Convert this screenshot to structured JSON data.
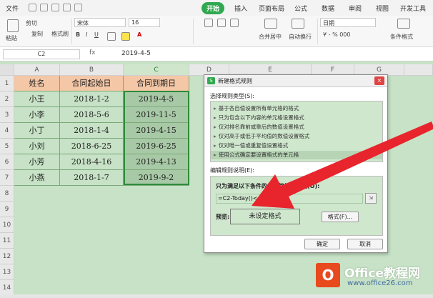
{
  "menubar": {
    "file": "文件",
    "tabs": [
      {
        "label": "开始",
        "active": true
      },
      {
        "label": "插入"
      },
      {
        "label": "页面布局"
      },
      {
        "label": "公式"
      },
      {
        "label": "数据"
      },
      {
        "label": "审阅"
      },
      {
        "label": "视图"
      },
      {
        "label": "开发工具"
      }
    ]
  },
  "ribbon": {
    "cut": "剪切",
    "paste": "粘贴",
    "copy": "复制",
    "format_painter": "格式刷",
    "font_name": "宋体",
    "font_size": "16",
    "merge_center": "合并居中",
    "wrap_text": "自动换行",
    "number_format": "日期",
    "conditional_format": "条件格式"
  },
  "formula_bar": {
    "name_box": "C2",
    "fx": "fx",
    "content": "2019-4-5"
  },
  "grid": {
    "columns": [
      "A",
      "B",
      "C",
      "D",
      "E",
      "F",
      "G"
    ],
    "rows": [
      "1",
      "2",
      "3",
      "4",
      "5",
      "6",
      "7",
      "8",
      "9",
      "10",
      "11",
      "12",
      "13",
      "14"
    ],
    "header": [
      "姓名",
      "合同起始日",
      "合同到期日"
    ],
    "data": [
      [
        "小王",
        "2018-1-2",
        "2019-4-5"
      ],
      [
        "小李",
        "2018-5-6",
        "2019-11-5"
      ],
      [
        "小丁",
        "2018-1-4",
        "2019-4-15"
      ],
      [
        "小刘",
        "2018-6-25",
        "2019-6-25"
      ],
      [
        "小芳",
        "2018-4-16",
        "2019-4-13"
      ],
      [
        "小燕",
        "2018-1-7",
        "2019-9-2"
      ]
    ]
  },
  "dialog": {
    "title": "新建格式规则",
    "close": "×",
    "rule_type_label": "选择规则类型(S):",
    "rule_types": [
      "基于各自值设置所有单元格的格式",
      "只为包含以下内容的单元格设置格式",
      "仅对排名靠前或靠后的数值设置格式",
      "仅对高于或低于平均值的数值设置格式",
      "仅对唯一值或重复值设置格式",
      "使用公式确定要设置格式的单元格"
    ],
    "edit_label": "编辑规则说明(E):",
    "formula_label": "只为满足以下条件的单元格设置格式(O):",
    "formula_value": "=C2-Today()<=30",
    "preview_label": "预览:",
    "preview_text": "未设定格式",
    "format_button": "格式(F)...",
    "ok_button": "确定",
    "cancel_button": "取消"
  },
  "watermark": {
    "logo": "O",
    "title": "Office教程网",
    "url": "www.office26.com"
  },
  "colors": {
    "accent": "#2fa84f",
    "header_fill": "#f4c7a6",
    "cell_fill": "#c7e2c6",
    "selected_fill": "#a8c9a6",
    "arrow": "#e8242c"
  }
}
